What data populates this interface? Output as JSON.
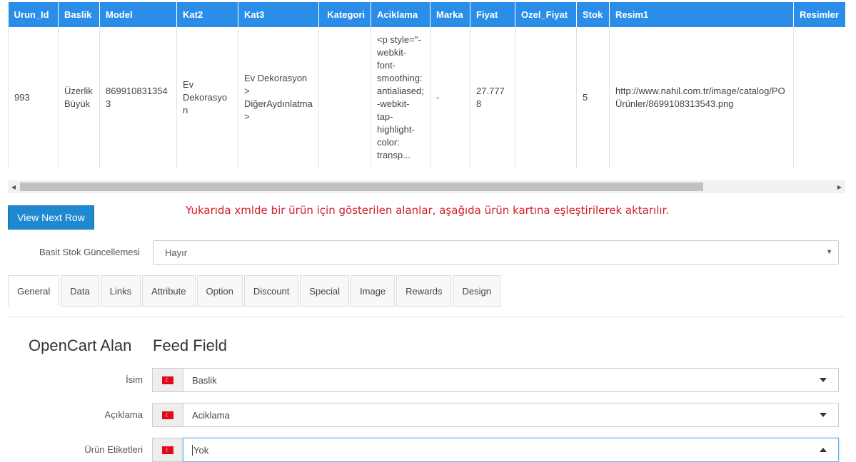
{
  "table": {
    "columns": [
      "Urun_Id",
      "Baslik",
      "Model",
      "Kat2",
      "Kat3",
      "Kategori",
      "Aciklama",
      "Marka",
      "Fiyat",
      "Ozel_Fiyat",
      "Stok",
      "Resim1",
      "Resimler"
    ],
    "row": {
      "urun_id": "993",
      "baslik": "Üzerlik Büyük",
      "model": "8699108313543",
      "kat2": "Ev Dekorasyon",
      "kat3": "Ev Dekorasyon > DiğerAydınlatma >",
      "kategori": "",
      "aciklama": "<p style=\"-webkit-font-smoothing: antialiased; -webkit-tap-highlight-color: transp...",
      "marka": "-",
      "fiyat": "27.7778",
      "ozel_fiyat": "",
      "stok": "5",
      "resim1": "http://www.nahil.com.tr/image/catalog/PO Ürünler/8699108313543.png",
      "resimler": ""
    }
  },
  "scrollbar": {
    "left_arrow": "◀",
    "right_arrow": "▶"
  },
  "next_button": {
    "label": "View Next Row"
  },
  "notice": "Yukarıda xmlde bir ürün için gösterilen alanlar, aşağıda ürün kartına eşleştirilerek aktarılır.",
  "stock": {
    "label": "Basit Stok Güncellemesi",
    "value": "Hayır",
    "caret": "▼"
  },
  "tabs": [
    "General",
    "Data",
    "Links",
    "Attribute",
    "Option",
    "Discount",
    "Special",
    "Image",
    "Rewards",
    "Design"
  ],
  "active_tab": "General",
  "headings": {
    "opencart": "OpenCart Alan",
    "feed": "Feed Field"
  },
  "fields": [
    {
      "label": "İsim",
      "value": "Baslik"
    },
    {
      "label": "Açıklama",
      "value": "Aciklama"
    },
    {
      "label": "Ürün Etiketleri",
      "value": "Yok"
    }
  ],
  "colors": {
    "header_blue": "#2a8ee8",
    "button_blue": "#1e88d0",
    "notice_red": "#d0202a",
    "flag_red": "#e30a17"
  }
}
